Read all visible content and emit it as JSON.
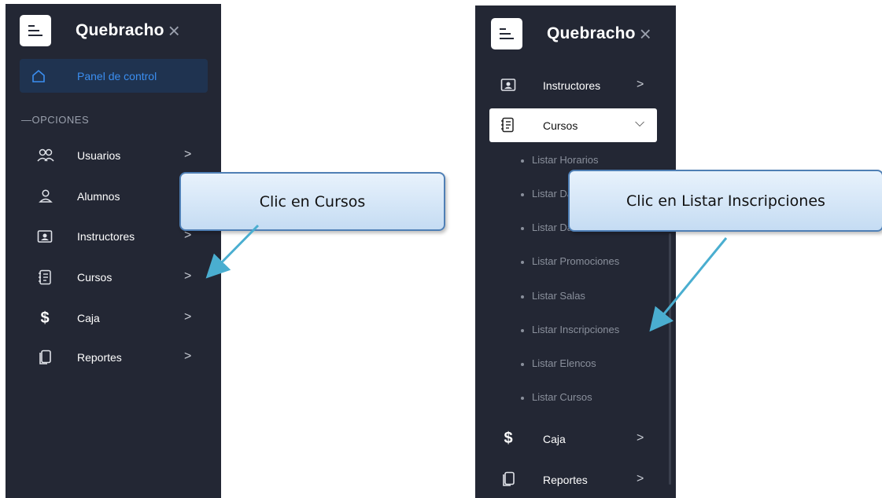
{
  "app": {
    "title": "Quebracho",
    "close_glyph": "×"
  },
  "left": {
    "active_item": {
      "label": "Panel de control",
      "icon": "home-icon"
    },
    "section": "—OPCIONES",
    "items": [
      {
        "label": "Usuarios",
        "icon": "users-icon",
        "chevron": ">"
      },
      {
        "label": "Alumnos",
        "icon": "user-icon",
        "chevron": ">"
      },
      {
        "label": "Instructores",
        "icon": "id-card-icon",
        "chevron": ">"
      },
      {
        "label": "Cursos",
        "icon": "notebook-icon",
        "chevron": ">"
      },
      {
        "label": "Caja",
        "icon": "dollar-icon",
        "chevron": ">"
      },
      {
        "label": "Reportes",
        "icon": "copy-icon",
        "chevron": ">"
      }
    ]
  },
  "right": {
    "items_top": [
      {
        "label": "Instructores",
        "icon": "id-card-icon",
        "chevron": ">"
      }
    ],
    "expanded": {
      "label": "Cursos",
      "icon": "notebook-icon",
      "chevron": "⌵"
    },
    "subitems": [
      "Listar Horarios",
      "Listar Danzas",
      "Listar Danzas",
      "Listar Promociones",
      "Listar Salas",
      "Listar Inscripciones",
      "Listar Elencos",
      "Listar Cursos"
    ],
    "items_bottom": [
      {
        "label": "Caja",
        "icon": "dollar-icon",
        "chevron": ">"
      },
      {
        "label": "Reportes",
        "icon": "copy-icon",
        "chevron": ">"
      }
    ]
  },
  "callouts": {
    "left": "Clic en Cursos",
    "right": "Clic en Listar Inscripciones"
  },
  "colors": {
    "sidebar_bg": "#232734",
    "active_bg": "#1f3350",
    "active_text": "#3b8ef0",
    "arrow": "#4aaed0"
  }
}
